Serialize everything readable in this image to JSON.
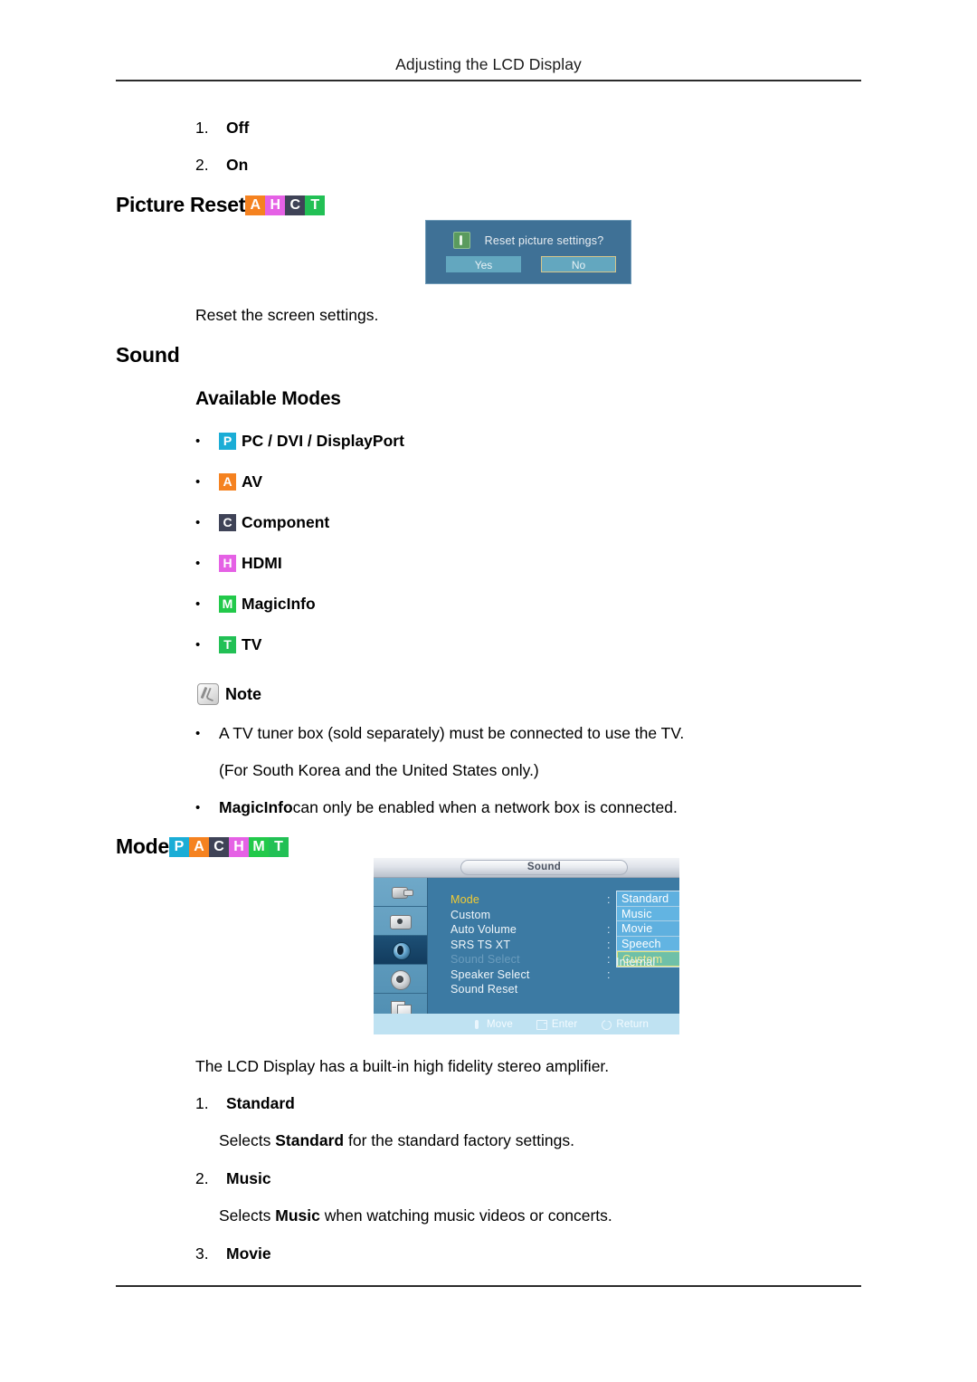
{
  "page": {
    "running_head": "Adjusting the LCD Display"
  },
  "top_list": [
    {
      "num": "1.",
      "label": "Off"
    },
    {
      "num": "2.",
      "label": "On"
    }
  ],
  "picture_reset": {
    "heading": "Picture Reset",
    "badges": [
      "A",
      "H",
      "C",
      "T"
    ],
    "description": "Reset the screen settings.",
    "dialog": {
      "message": "Reset picture settings?",
      "yes_label": "Yes",
      "no_label": "No"
    }
  },
  "sound_section": {
    "heading": "Sound",
    "available_modes_heading": "Available Modes",
    "modes": [
      {
        "badge": "P",
        "label": "PC / DVI / DisplayPort"
      },
      {
        "badge": "A",
        "label": "AV"
      },
      {
        "badge": "C",
        "label": "Component"
      },
      {
        "badge": "H",
        "label": "HDMI"
      },
      {
        "badge": "M",
        "label": "MagicInfo"
      },
      {
        "badge": "T",
        "label": "TV"
      }
    ],
    "note": {
      "label": "Note",
      "bullets": [
        "A TV tuner box (sold separately) must be connected to use the TV.",
        "MagicInfo can only be enabled when a network box is connected."
      ],
      "bullet1_continued": "(For South Korea and the United States only.)",
      "bullet2_bold_lead": "MagicInfo",
      "bullet2_rest": " can only be enabled when a network box is connected."
    }
  },
  "mode_section": {
    "heading": "Mode",
    "badges": [
      "P",
      "A",
      "C",
      "H",
      "M",
      "T"
    ],
    "intro": "The LCD Display has a built-in high fidelity stereo amplifier.",
    "items": [
      {
        "num": "1.",
        "label": "Standard",
        "desc_pre": "Selects ",
        "desc_bold": "Standard",
        "desc_post": " for the standard factory settings."
      },
      {
        "num": "2.",
        "label": "Music",
        "desc_pre": "Selects ",
        "desc_bold": "Music",
        "desc_post": " when watching music videos or concerts."
      },
      {
        "num": "3.",
        "label": "Movie"
      }
    ]
  },
  "osd": {
    "title": "Sound",
    "sidebar_icons": [
      "input-icon",
      "picture-icon",
      "sound-icon",
      "setup-icon",
      "multi-control-icon"
    ],
    "menu_items": [
      {
        "label": "Mode",
        "state": "selected"
      },
      {
        "label": "Custom",
        "state": "normal"
      },
      {
        "label": "Auto Volume",
        "state": "normal"
      },
      {
        "label": "SRS TS XT",
        "state": "normal"
      },
      {
        "label": "Sound Select",
        "state": "disabled"
      },
      {
        "label": "Speaker Select",
        "state": "normal"
      },
      {
        "label": "Sound Reset",
        "state": "normal"
      }
    ],
    "dropdown_options": [
      {
        "label": "Standard",
        "highlight": false
      },
      {
        "label": "Music",
        "highlight": false
      },
      {
        "label": "Movie",
        "highlight": false
      },
      {
        "label": "Speech",
        "highlight": false
      },
      {
        "label": "Custom",
        "highlight": true
      }
    ],
    "speaker_select_value": "Internal",
    "footer": [
      {
        "icon": "move-icon",
        "label": "Move"
      },
      {
        "icon": "enter-icon",
        "label": "Enter"
      },
      {
        "icon": "return-icon",
        "label": "Return"
      }
    ]
  },
  "colors": {
    "badge_P": "#1badd6",
    "badge_A": "#f58220",
    "badge_C": "#3f4357",
    "badge_H": "#e561e5",
    "badge_M": "#22c94a",
    "badge_T": "#22c055",
    "dialog_bg": "#3f7196",
    "osd_bg": "#3c7aa3",
    "osd_selected_text": "#f3cc33"
  }
}
